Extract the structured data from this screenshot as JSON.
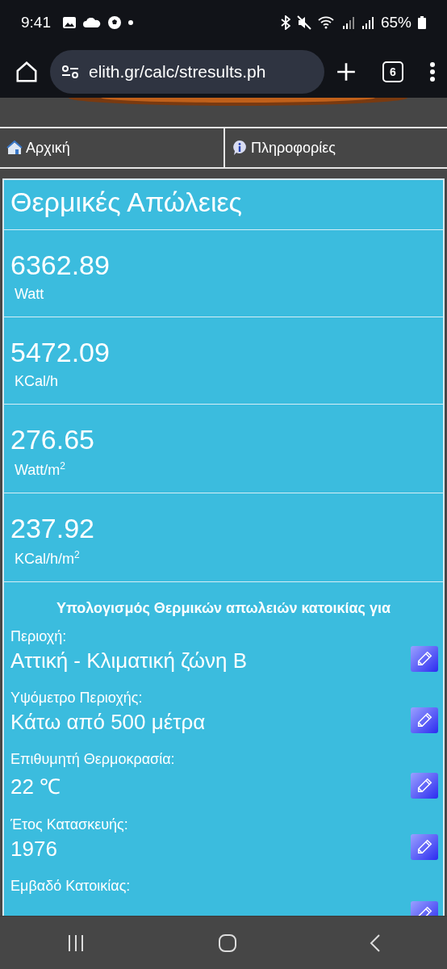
{
  "status_bar": {
    "time": "9:41",
    "battery": "65%"
  },
  "browser": {
    "url": "elith.gr/calc/stresults.ph",
    "tab_count": "6"
  },
  "nav": [
    {
      "label": "Αρχική",
      "kind": "home"
    },
    {
      "label": "Πληροφορίες",
      "kind": "info"
    }
  ],
  "results": {
    "title": "Θερμικές Απώλειες",
    "rows": [
      {
        "value": "6362.89",
        "unit": "Watt"
      },
      {
        "value": "5472.09",
        "unit": "KCal/h"
      },
      {
        "value": "276.65",
        "unit": "Watt/m$^{2}$"
      },
      {
        "value": "237.92",
        "unit": "KCal/h/m$^{2}$"
      }
    ]
  },
  "summary": {
    "heading": "Υπολογισμός Θερμικών απωλειών κατοικίας για",
    "fields": [
      {
        "label": "Περιοχή:",
        "value": "Αττική - Κλιματική ζώνη Β"
      },
      {
        "label": "Υψόμετρο Περιοχής:",
        "value": "Κάτω από 500 μέτρα"
      },
      {
        "label": "Επιθυμητή Θερμοκρασία:",
        "value": "22 ℃"
      },
      {
        "label": "Έτος Κατασκευής:",
        "value": "1976"
      },
      {
        "label": "Εμβαδό Κατοικίας:"
      }
    ]
  }
}
